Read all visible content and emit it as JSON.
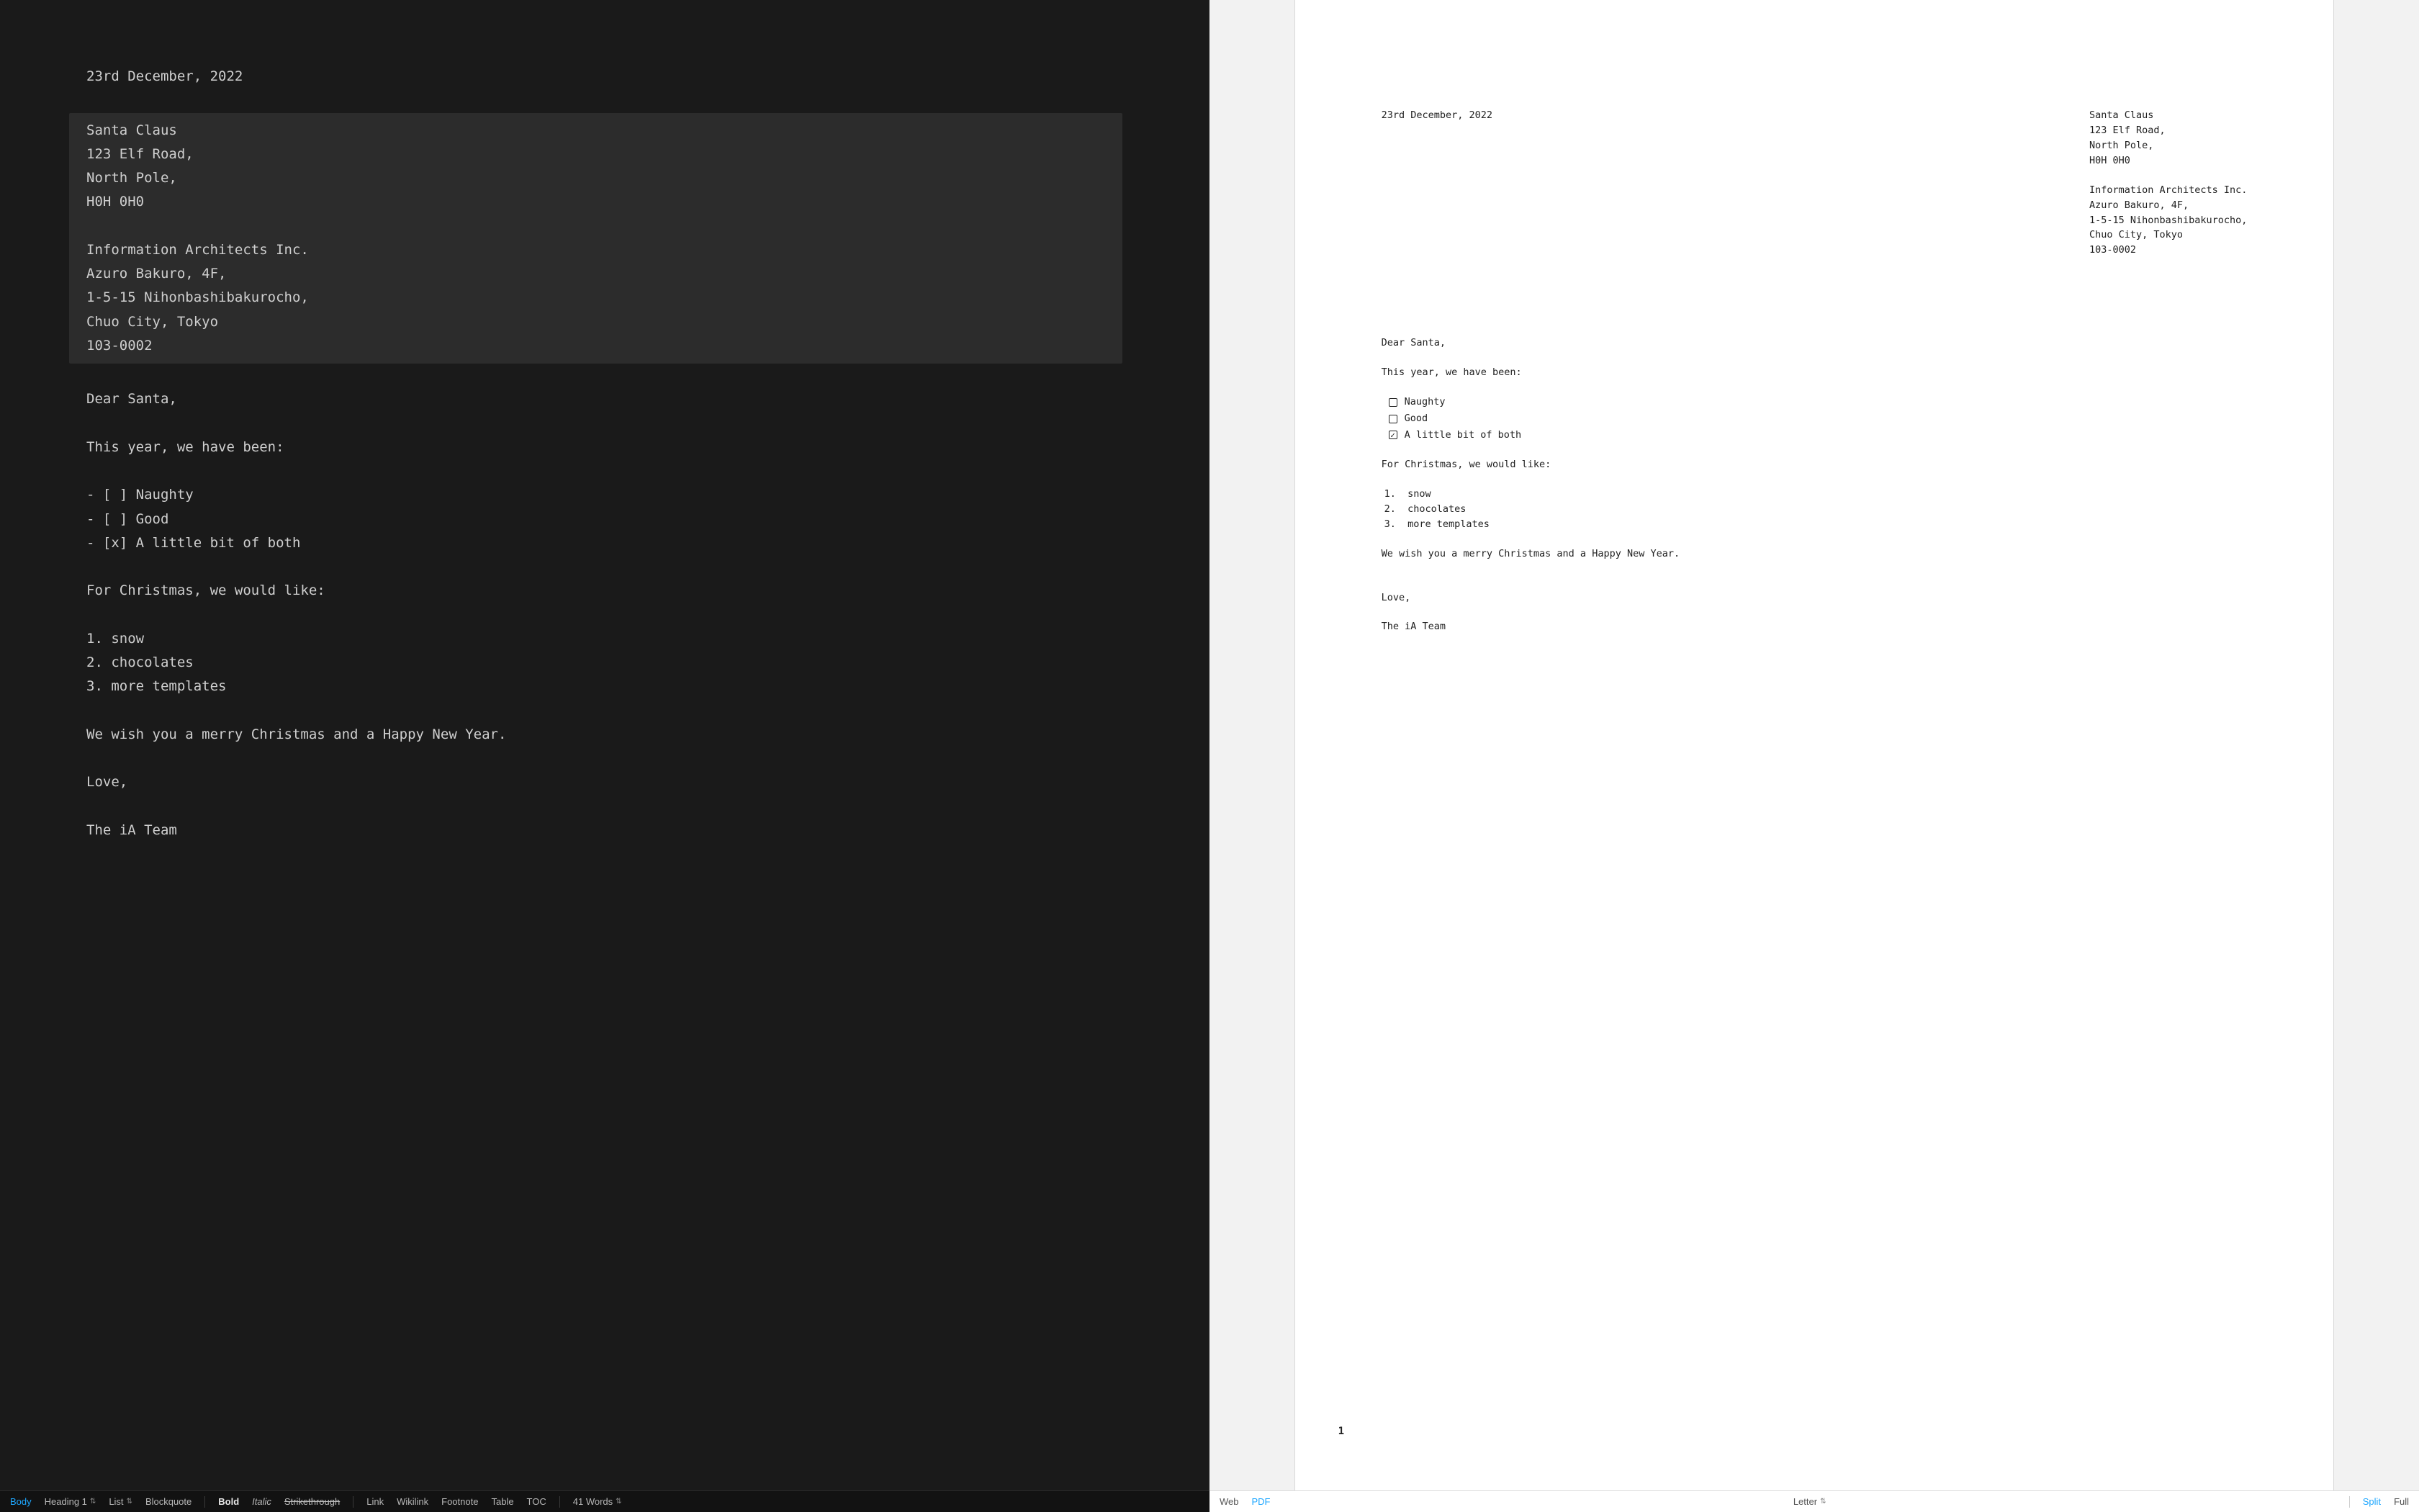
{
  "colors": {
    "accent": "#1ea7ff",
    "editor_bg": "#1a1a1a",
    "preview_bg": "#f2f2f2"
  },
  "letter": {
    "date": "23rd December, 2022",
    "recipient": {
      "name": "Santa Claus",
      "street": "123 Elf Road,",
      "city": "North Pole,",
      "postcode": "H0H 0H0"
    },
    "sender": {
      "name": "Information Architects Inc.",
      "building": "Azuro Bakuro, 4F,",
      "street": "1-5-15 Nihonbashibakurocho,",
      "city": "Chuo City, Tokyo",
      "postcode": "103-0002"
    },
    "salutation": "Dear Santa,",
    "lead_in": "This year, we have been:",
    "checklist": [
      {
        "label": "Naughty",
        "checked": false
      },
      {
        "label": "Good",
        "checked": false
      },
      {
        "label": "A little bit of both",
        "checked": true
      }
    ],
    "wish_lead_in": "For Christmas, we would like:",
    "wishes": [
      "snow",
      "chocolates",
      "more templates"
    ],
    "closing_line": "We wish you a merry Christmas and a Happy New Year.",
    "signoff": "Love,",
    "signature": "The iA Team"
  },
  "editor_source": {
    "checklist_lines": [
      "- [ ] Naughty",
      "- [ ] Good",
      "- [x] A little bit of both"
    ],
    "ordered_lines": [
      "1. snow",
      "2. chocolates",
      "3. more templates"
    ]
  },
  "preview": {
    "page_number": "1"
  },
  "toolbar": {
    "left": {
      "body": "Body",
      "heading": "Heading 1",
      "list": "List",
      "blockquote": "Blockquote",
      "bold": "Bold",
      "italic": "Italic",
      "strike": "Strikethrough",
      "link": "Link",
      "wikilink": "Wikilink",
      "footnote": "Footnote",
      "table": "Table",
      "toc": "TOC",
      "words": "41 Words"
    },
    "right": {
      "web": "Web",
      "pdf": "PDF",
      "paper": "Letter",
      "split": "Split",
      "full": "Full"
    }
  }
}
